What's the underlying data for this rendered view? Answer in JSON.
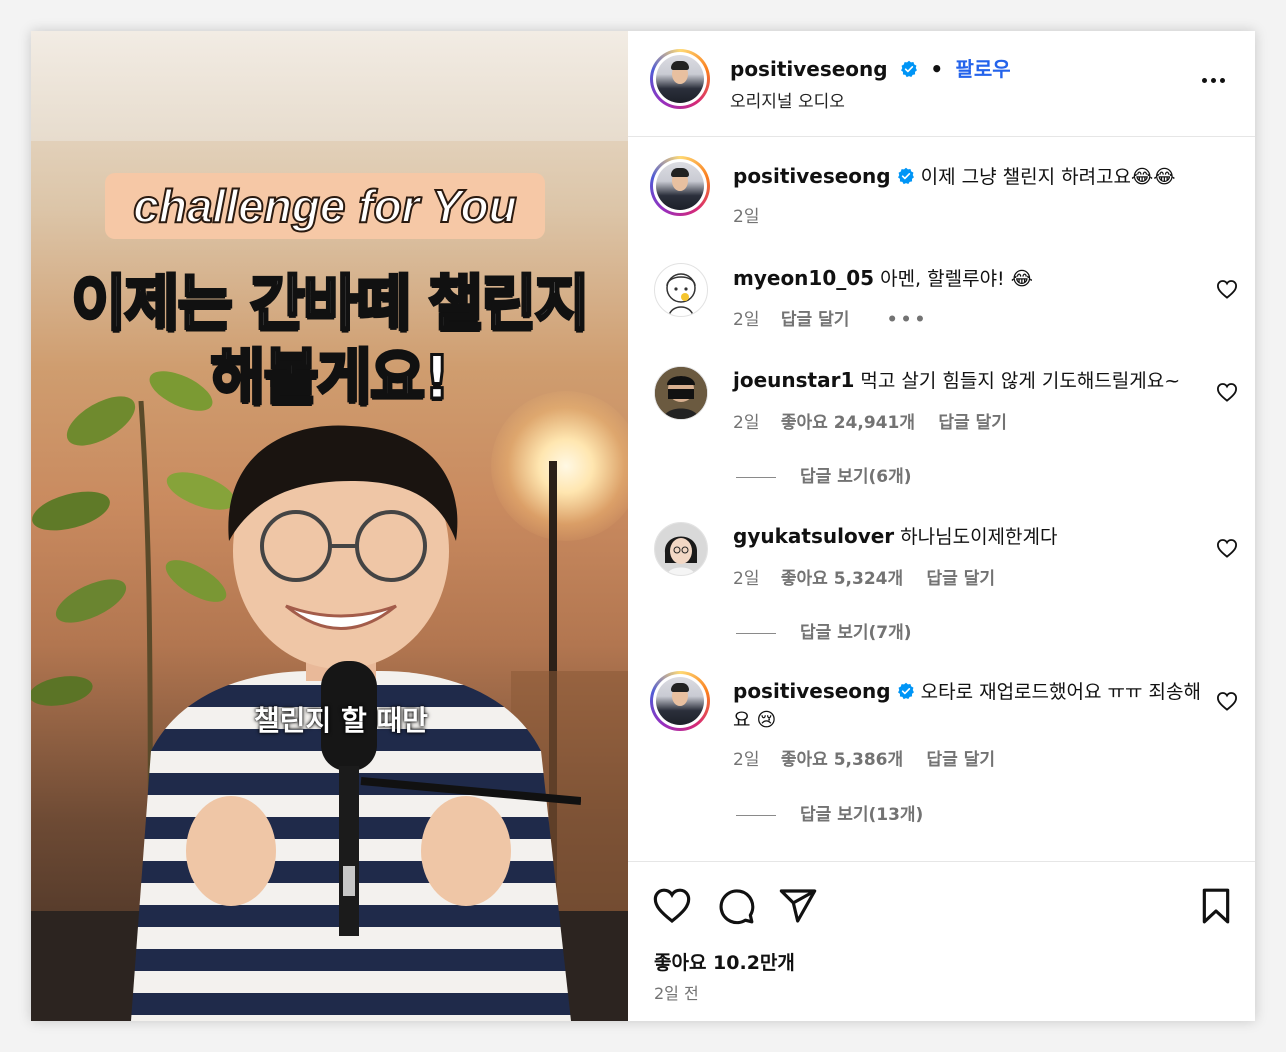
{
  "media": {
    "overlay_title": "challenge for You",
    "overlay_line1": "이제는 간바떼 챌린지",
    "overlay_line2": "해볼게요!",
    "caption": "챌린지 할 때만"
  },
  "header": {
    "username": "positiveseong",
    "follow_label": "팔로우",
    "dot": "•",
    "subtitle": "오리지널 오디오"
  },
  "caption_comment": {
    "username": "positiveseong",
    "text": "이제 그냥 챌린지 하려고요😂😂",
    "time": "2일"
  },
  "comments": [
    {
      "username": "myeon10_05",
      "text": "아멘, 할렐루야! 😂",
      "time": "2일",
      "reply_label": "답글 달기",
      "more": "•••"
    },
    {
      "username": "joeunstar1",
      "text": "먹고 살기 힘들지 않게 기도해드릴게요~",
      "time": "2일",
      "likes": "좋아요 24,941개",
      "reply_label": "답글 달기",
      "view_replies": "답글 보기(6개)"
    },
    {
      "username": "gyukatsulover",
      "text": "하나님도이제한계다",
      "time": "2일",
      "likes": "좋아요 5,324개",
      "reply_label": "답글 달기",
      "view_replies": "답글 보기(7개)"
    },
    {
      "username": "positiveseong",
      "text": "오타로 재업로드했어요 ㅠㅠ 죄송해요 😢",
      "time": "2일",
      "likes": "좋아요 5,386개",
      "reply_label": "답글 달기",
      "view_replies": "답글 보기(13개)"
    }
  ],
  "footer": {
    "likes": "좋아요 10.2만개",
    "posted": "2일 전"
  },
  "icons": {
    "verified": "verified-badge-icon",
    "heart": "heart-icon",
    "comment": "comment-icon",
    "share": "share-icon",
    "bookmark": "bookmark-icon",
    "more": "more-options-icon"
  },
  "colors": {
    "accent_blue": "#2463eb",
    "meta_gray": "#737373",
    "verified_blue": "#0095f6"
  }
}
